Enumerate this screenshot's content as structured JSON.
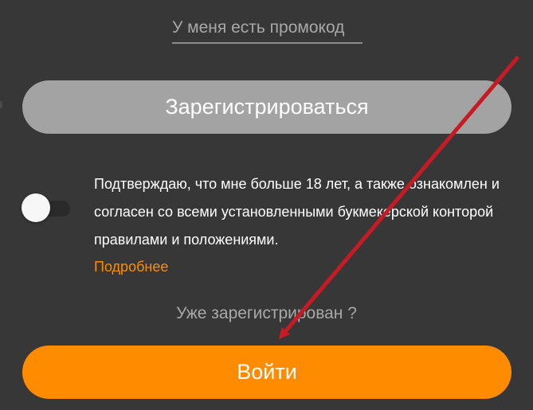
{
  "promo": {
    "link_label": "У меня есть промокод"
  },
  "register": {
    "button_label": "Зарегистрироваться"
  },
  "agreement": {
    "toggle_state": "off",
    "text": "Подтверждаю, что мне больше 18 лет, а также ознакомлен и согласен со всеми установленными букмекерской конторой правилами и положениями.",
    "more_link_label": "Подробнее"
  },
  "login": {
    "already_registered_label": "Уже зарегистрирован ?",
    "button_label": "Войти"
  },
  "colors": {
    "background": "#373737",
    "accent": "#ff8c00",
    "disabled_button": "#a3a3a3",
    "muted_text": "#a8a8a8",
    "annotation_arrow": "#c61b24"
  }
}
